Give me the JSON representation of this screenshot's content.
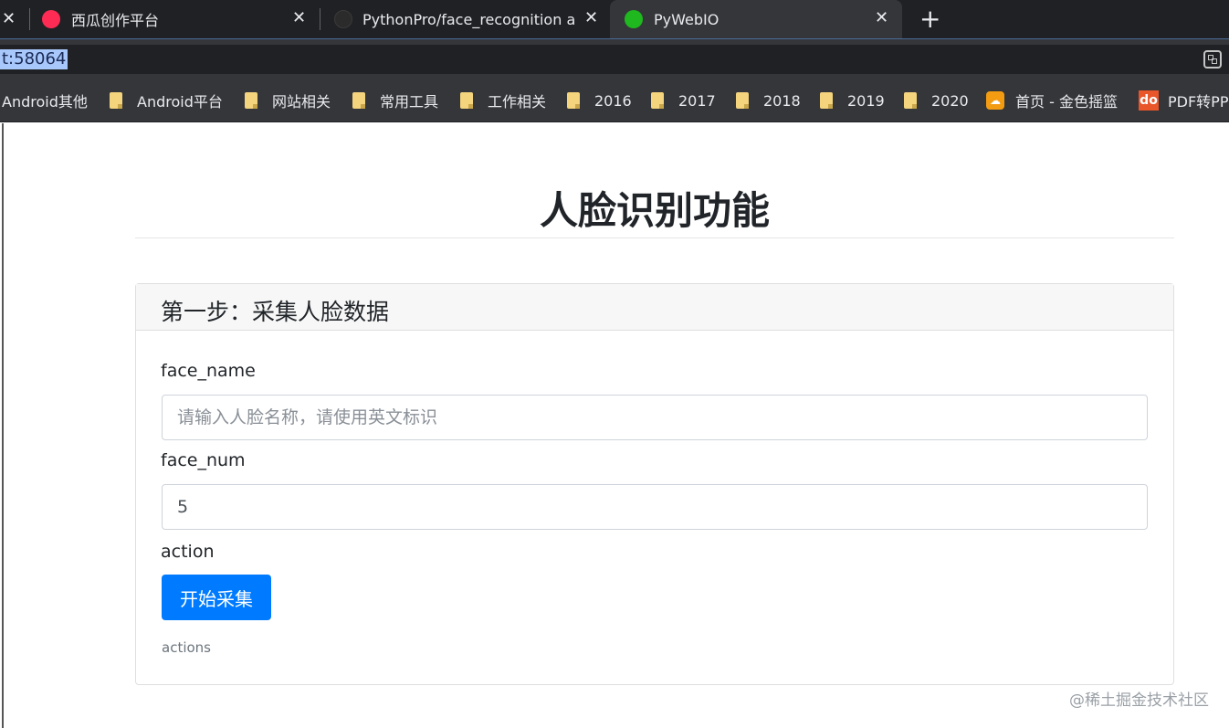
{
  "browser": {
    "tabs": [
      {
        "title": "西瓜创作平台",
        "active": false
      },
      {
        "title": "PythonPro/face_recognition at",
        "active": false
      },
      {
        "title": "PyWebIO",
        "active": true
      }
    ],
    "close_glyph": "✕",
    "new_tab_glyph": "+",
    "url": "t:58064"
  },
  "bookmarks": [
    {
      "label": "Android其他",
      "icon": "none"
    },
    {
      "label": "Android平台",
      "icon": "folder-icon"
    },
    {
      "label": "网站相关",
      "icon": "folder-icon"
    },
    {
      "label": "常用工具",
      "icon": "folder-icon"
    },
    {
      "label": "工作相关",
      "icon": "folder-icon"
    },
    {
      "label": "2016",
      "icon": "folder-icon"
    },
    {
      "label": "2017",
      "icon": "folder-icon"
    },
    {
      "label": "2018",
      "icon": "folder-icon"
    },
    {
      "label": "2019",
      "icon": "folder-icon"
    },
    {
      "label": "2020",
      "icon": "folder-icon"
    },
    {
      "label": "首页 - 金色摇篮",
      "icon": "site-icon"
    },
    {
      "label": "PDF转PP",
      "icon": "do-icon",
      "icon_text": "do"
    }
  ],
  "page": {
    "title": "人脸识别功能",
    "card": {
      "header": "第一步：采集人脸数据",
      "fields": {
        "face_name": {
          "label": "face_name",
          "placeholder": "请输入人脸名称，请使用英文标识",
          "value": ""
        },
        "face_num": {
          "label": "face_num",
          "value": "5"
        },
        "action": {
          "label": "action",
          "button_label": "开始采集",
          "help": "actions"
        }
      }
    }
  },
  "watermark": "@稀土掘金技术社区",
  "colors": {
    "primary": "#007bff",
    "tab_bar": "#202124",
    "toolbar": "#35363a"
  }
}
